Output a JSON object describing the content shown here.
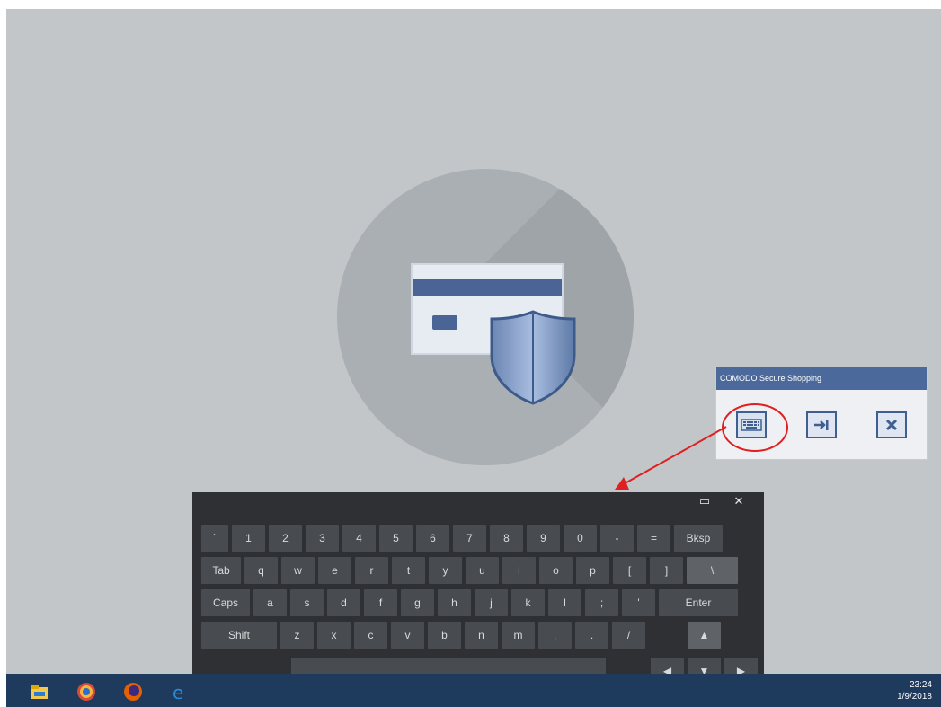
{
  "window": {
    "title": "COMODO Secure Shopping",
    "buttons": [
      {
        "name": "keyboard",
        "icon": "keyboard-icon"
      },
      {
        "name": "exit",
        "icon": "exit-arrow-icon"
      },
      {
        "name": "close",
        "icon": "close-x-icon"
      }
    ]
  },
  "keyboard": {
    "controls": {
      "restore": "▭",
      "close": "✕"
    },
    "rows": [
      [
        "`",
        "1",
        "2",
        "3",
        "4",
        "5",
        "6",
        "7",
        "8",
        "9",
        "0",
        "-",
        "=",
        "Bksp"
      ],
      [
        "Tab",
        "q",
        "w",
        "e",
        "r",
        "t",
        "y",
        "u",
        "i",
        "o",
        "p",
        "[",
        "]",
        "\\"
      ],
      [
        "Caps",
        "a",
        "s",
        "d",
        "f",
        "g",
        "h",
        "j",
        "k",
        "l",
        ";",
        "'",
        "Enter"
      ],
      [
        "Shift",
        "z",
        "x",
        "c",
        "v",
        "b",
        "n",
        "m",
        ",",
        ".",
        "/",
        "▲"
      ],
      [
        "",
        "◀",
        "▼",
        "▶"
      ]
    ]
  },
  "taskbar": {
    "apps": [
      "file-explorer-icon",
      "chrome-like-icon",
      "firefox-icon",
      "edge-icon"
    ],
    "time": "23:24",
    "date": "1/9/2018"
  },
  "colors": {
    "desktop": "#c3c6c8",
    "accent": "#4b6a9b",
    "highlight": "#e02020",
    "keyboard_bg": "#2e3033",
    "taskbar": "#1e3a5c"
  }
}
